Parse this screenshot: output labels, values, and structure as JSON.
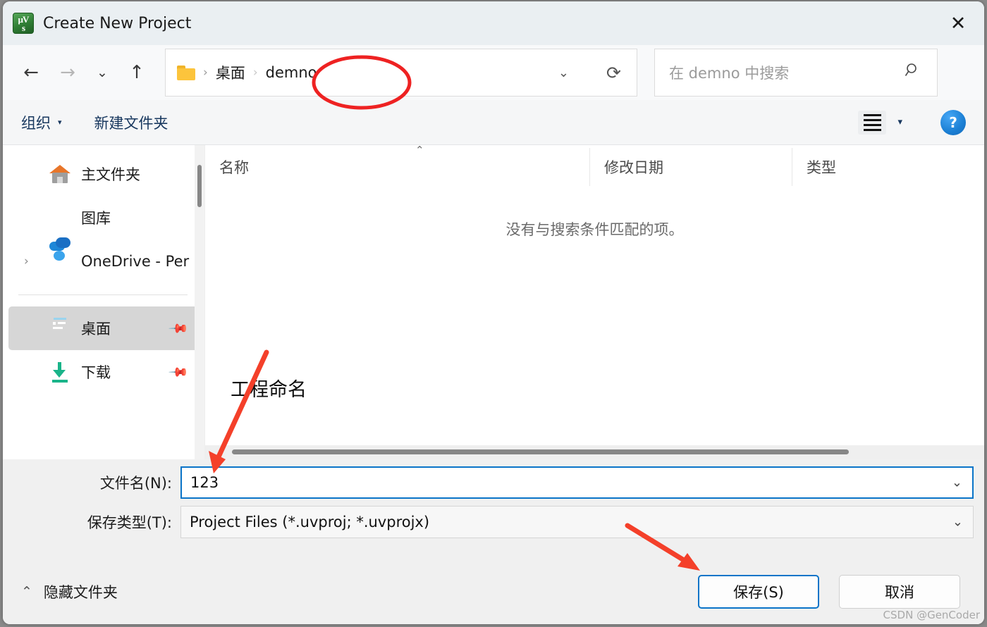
{
  "window": {
    "title": "Create New Project",
    "app_icon": "keil-uvision-icon",
    "close_label": "✕"
  },
  "nav": {
    "back": "←",
    "forward": "→",
    "recent": "⌄",
    "up": "↑",
    "address_chevron": "⌄",
    "refresh": "⟳",
    "breadcrumbs": [
      {
        "label": "桌面"
      },
      {
        "label": "demno"
      }
    ],
    "separator": "›"
  },
  "search": {
    "placeholder": "在 demno 中搜索",
    "icon": "search-icon"
  },
  "toolbar": {
    "organize_label": "组织",
    "organize_caret": "▾",
    "new_folder_label": "新建文件夹",
    "view_caret": "▾",
    "help_label": "?"
  },
  "sidebar": {
    "items": [
      {
        "label": "主文件夹",
        "icon": "home-icon",
        "expander": "",
        "pin": "",
        "selected": false
      },
      {
        "label": "图库",
        "icon": "gallery-icon",
        "expander": "",
        "pin": "",
        "selected": false
      },
      {
        "label": "OneDrive - Per",
        "icon": "onedrive-icon",
        "expander": "›",
        "pin": "",
        "selected": false
      },
      {
        "label": "桌面",
        "icon": "desktop-icon",
        "expander": "",
        "pin": "📌",
        "selected": true
      },
      {
        "label": "下载",
        "icon": "download-icon",
        "expander": "",
        "pin": "📌",
        "selected": false
      }
    ]
  },
  "filelist": {
    "columns": [
      {
        "label": "名称"
      },
      {
        "label": "修改日期"
      },
      {
        "label": "类型"
      }
    ],
    "sort_caret": "⌃",
    "empty_message": "没有与搜索条件匹配的项。",
    "rows": []
  },
  "annotations": {
    "project_name_note": "工程命名",
    "ellipse_color": "#ee2222",
    "arrow_color": "#f4402a"
  },
  "form": {
    "filename_label": "文件名(N):",
    "filename_value": "123",
    "filename_chevron": "⌄",
    "filetype_label": "保存类型(T):",
    "filetype_value": "Project Files (*.uvproj; *.uvprojx)",
    "filetype_chevron": "⌄"
  },
  "actions": {
    "hide_folders_caret": "⌃",
    "hide_folders_label": "隐藏文件夹",
    "save_label": "保存(S)",
    "cancel_label": "取消"
  },
  "watermark": {
    "text": "CSDN @GenCoder"
  }
}
